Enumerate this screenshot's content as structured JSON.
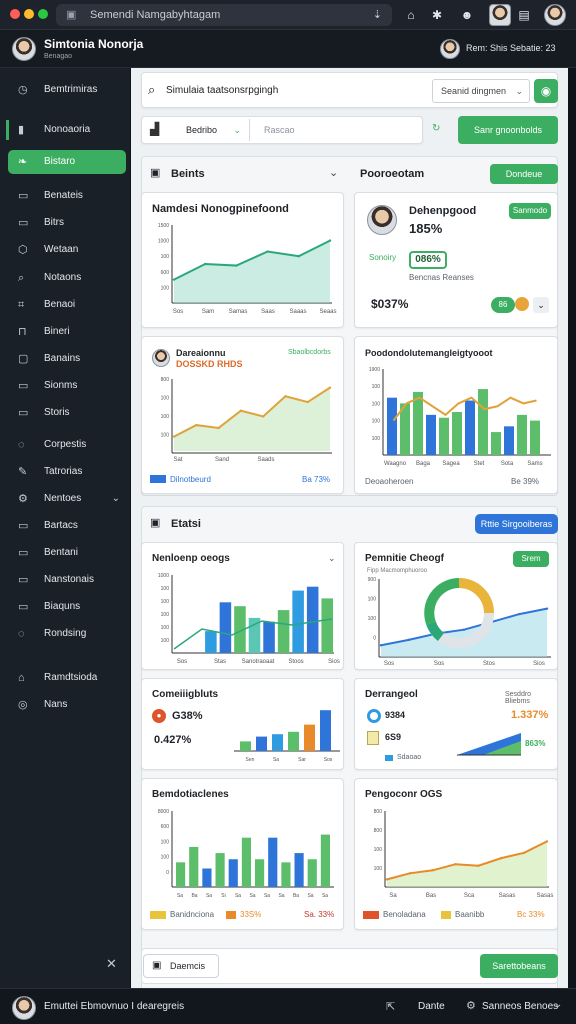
{
  "browser": {
    "url": "Semendi Namgabyhtagam"
  },
  "header": {
    "title": "Simtonia Nonorja",
    "subtitle": "Benagao",
    "user_text": "Rem: Shis",
    "menu_text": "Sebatie: 23"
  },
  "sidebar": {
    "items": [
      {
        "label": "Bemtrimiras",
        "icon": "clock-icon"
      },
      {
        "label": "Nonoaoria",
        "icon": "bar-icon"
      },
      {
        "label": "Bistaro",
        "icon": "leaf-icon"
      },
      {
        "label": "Benateis",
        "icon": "doc-icon"
      },
      {
        "label": "Bitrs",
        "icon": "doc-icon"
      },
      {
        "label": "Wetaan",
        "icon": "shape-icon"
      },
      {
        "label": "Notaons",
        "icon": "search-icon"
      },
      {
        "label": "Benaoi",
        "icon": "tag-icon"
      },
      {
        "label": "Bineri",
        "icon": "cart-icon"
      },
      {
        "label": "Banains",
        "icon": "box-icon"
      },
      {
        "label": "Sionms",
        "icon": "doc-icon"
      },
      {
        "label": "Storis",
        "icon": "doc-icon"
      },
      {
        "label": "Corpestis",
        "icon": "chat-icon"
      },
      {
        "label": "Tatrorias",
        "icon": "edit-icon"
      },
      {
        "label": "Nentoes",
        "icon": "gear-icon"
      },
      {
        "label": "Bartacs",
        "icon": "doc-icon"
      },
      {
        "label": "Bentani",
        "icon": "doc-icon"
      },
      {
        "label": "Nanstonais",
        "icon": "doc-icon"
      },
      {
        "label": "Biaquns",
        "icon": "doc-icon"
      },
      {
        "label": "Rondsing",
        "icon": "chat-icon"
      },
      {
        "label": "Ramdtsioda",
        "icon": "home-icon"
      },
      {
        "label": "Nans",
        "icon": "user-icon"
      }
    ]
  },
  "toolbar": {
    "search_text": "Simulaia taatsonsrpgingh",
    "select_text": "Seanid dingmen",
    "filter_label": "Bedribo",
    "input_placeholder": "Rascao",
    "action_button": "Sanr gnoonbolds"
  },
  "section1": {
    "left_label": "Beints",
    "right_label": "Pooroeotam",
    "right_button": "Dondeue"
  },
  "card1": {
    "title": "Namdesi Nonogpinefoond",
    "chart_data": {
      "type": "area",
      "title": "Namdesi Nonogpinefoond",
      "x": [
        "Sos",
        "Sam",
        "Samas",
        "Saas",
        "Saaas",
        "Seaas"
      ],
      "values": [
        15,
        25,
        24,
        33,
        30,
        40
      ],
      "ylim": [
        0,
        50
      ],
      "ticks": [
        "1500",
        "1000",
        "100",
        "600",
        "100"
      ]
    }
  },
  "card2": {
    "title": "Dehenpgood",
    "percent": "185%",
    "badge": "086%",
    "sub_label": "Sonoiry",
    "sub_text": "Bencnas Reanses",
    "big_value": "$037%",
    "button": "Sanmodo",
    "pill": "86"
  },
  "card3": {
    "title": "Dareaionnu",
    "subtitle": "DOSSKD RHDS",
    "badge": "Sbaolbcdorbs",
    "legend": "Dilnotbeurd",
    "value": "Ba 73%",
    "chart_data": {
      "type": "area",
      "x": [
        "Sat",
        "Sand",
        "Saads"
      ],
      "values": [
        10,
        18,
        16,
        28,
        24,
        38,
        34,
        44
      ],
      "ylim": [
        0,
        50
      ],
      "ticks": [
        "800",
        "100",
        "100",
        "100"
      ]
    }
  },
  "card4": {
    "title": "Poodondolutemangleigtyooot",
    "legend": "Deoaoheroen",
    "value": "Be 39%",
    "chart_data": {
      "type": "bar",
      "categories": [
        "Waagno",
        "Baga",
        "Sagea",
        "Stet",
        "Sota",
        "Sams"
      ],
      "series": [
        {
          "name": "A",
          "values": [
            100,
            90,
            110,
            70,
            65,
            75,
            95,
            115,
            40,
            50,
            70,
            60
          ]
        },
        {
          "name": "line",
          "values": [
            60,
            90,
            100,
            85,
            70,
            90,
            100,
            80,
            85,
            100,
            90,
            95
          ]
        }
      ],
      "ylim": [
        0,
        150
      ],
      "ticks": [
        "1900",
        "100",
        "100",
        "100",
        "100"
      ]
    }
  },
  "section2": {
    "label": "Etatsi",
    "button": "Rttie Sirgooiberas"
  },
  "card5": {
    "title": "Nenloenp oeogs",
    "chart_data": {
      "type": "bar",
      "categories": [
        "Sos",
        "Stas",
        "Sanotraoaat",
        "Stoos",
        "Sios"
      ],
      "values": [
        20,
        45,
        28,
        65,
        60,
        45,
        40,
        55,
        80,
        85,
        70
      ],
      "ylim": [
        0,
        100
      ],
      "ticks": [
        "1000",
        "100",
        "100",
        "100",
        "100",
        "100"
      ]
    }
  },
  "card6": {
    "title": "Pemnitie Cheogf",
    "subtitle": "Fipp Macmomphuoroo",
    "button": "Srem",
    "chart_data": {
      "type": "area",
      "x": [
        "Sos",
        "Sos",
        "Stos",
        "Sios"
      ],
      "values": [
        15,
        22,
        30,
        35,
        45,
        55,
        62
      ],
      "ylim": [
        0,
        100
      ],
      "ticks": [
        "900",
        "100",
        "100",
        "0"
      ]
    }
  },
  "card7": {
    "title": "Comeiiigbluts",
    "stat1": "G38%",
    "stat2": "0.427%",
    "chart_data": {
      "type": "bar",
      "categories": [
        "Sen",
        "Sa",
        "Sar",
        "Sos"
      ],
      "values": [
        20,
        30,
        35,
        40,
        55,
        85
      ],
      "ylim": [
        0,
        100
      ]
    }
  },
  "card8": {
    "title": "Derrangeol",
    "meta": "Sesddro Bliebms",
    "stat1": "9384",
    "stat1_value": "1.337%",
    "stat2": "6S9",
    "stat2_value": "863%",
    "legend": "Sdaoao",
    "chart_data": {
      "type": "bar",
      "values": [
        30,
        45,
        60
      ],
      "ylim": [
        0,
        100
      ]
    }
  },
  "card9": {
    "title": "Bemdotiaclenes",
    "legend1": "Banidnciona",
    "legend2": "33S%",
    "value": "Sa. 33%",
    "chart_data": {
      "type": "bar",
      "categories": [
        "Sa",
        "Ba",
        "Sa",
        "Si",
        "Sa",
        "Sa",
        "Sa",
        "Sa",
        "Ba",
        "Sa",
        "Sa"
      ],
      "values": [
        40,
        65,
        30,
        55,
        45,
        80,
        45,
        80,
        40,
        55,
        45,
        85
      ],
      "ylim": [
        0,
        120
      ],
      "ticks": [
        "8000",
        "600",
        "100",
        "100",
        "0"
      ]
    }
  },
  "card10": {
    "title": "Pengoconr OGS",
    "legend1": "Benoladana",
    "legend2": "Baanibb",
    "value": "Bc 33%",
    "chart_data": {
      "type": "area",
      "x": [
        "Sa",
        "Bas",
        "Sca",
        "Sasas",
        "Sasas"
      ],
      "values": [
        10,
        18,
        22,
        30,
        28,
        38,
        45,
        60
      ],
      "ylim": [
        0,
        100
      ],
      "ticks": [
        "800",
        "800",
        "100",
        "100"
      ]
    }
  },
  "bottom": {
    "left_button": "Daemcis",
    "right_button": "Sarettobeans"
  },
  "footer": {
    "title": "Emuttei Ebmovnuo I dearegreis",
    "link1": "Dante",
    "link2": "Sanneos Benoes"
  },
  "colors": {
    "green": "#3cae62",
    "blue": "#2f74d9",
    "teal": "#5cc6b4",
    "sidebar": "#1a2028",
    "orange": "#e88a2a"
  }
}
